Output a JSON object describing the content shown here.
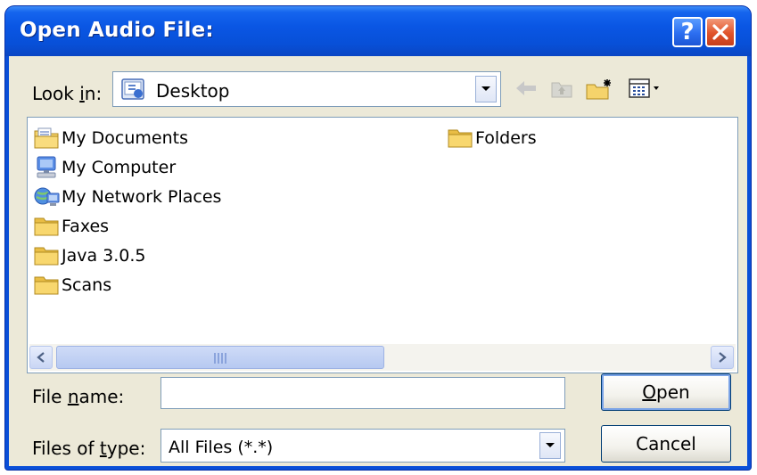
{
  "window": {
    "title": "Open Audio File:"
  },
  "titlebar": {
    "help_label": "?"
  },
  "look_in": {
    "label_pre": "Look ",
    "label_accel": "i",
    "label_post": "n:",
    "value": "Desktop"
  },
  "toolbar": {
    "icons": [
      "back-arrow-icon",
      "up-folder-icon",
      "new-folder-icon",
      "view-menu-icon"
    ]
  },
  "file_list": {
    "items": [
      {
        "label": "My Documents",
        "icon": "my-documents-icon"
      },
      {
        "label": "My Computer",
        "icon": "my-computer-icon"
      },
      {
        "label": "My Network Places",
        "icon": "network-places-icon"
      },
      {
        "label": "Faxes",
        "icon": "folder-icon"
      },
      {
        "label": "Java 3.0.5",
        "icon": "folder-icon"
      },
      {
        "label": "Scans",
        "icon": "folder-icon"
      },
      {
        "label": "Folders",
        "icon": "folder-icon"
      }
    ]
  },
  "file_name": {
    "label_pre": "File ",
    "label_accel": "n",
    "label_post": "ame:",
    "value": ""
  },
  "file_type": {
    "label_pre": "Files of ",
    "label_accel": "t",
    "label_post": "ype:",
    "value": "All Files (*.*)"
  },
  "buttons": {
    "open_accel": "O",
    "open_rest": "pen",
    "cancel": "Cancel"
  },
  "colors": {
    "titlebar": "#0a56e4",
    "client_bg": "#ece9d8",
    "close_button": "#e0532a",
    "folder_yellow": "#f5d36b"
  }
}
